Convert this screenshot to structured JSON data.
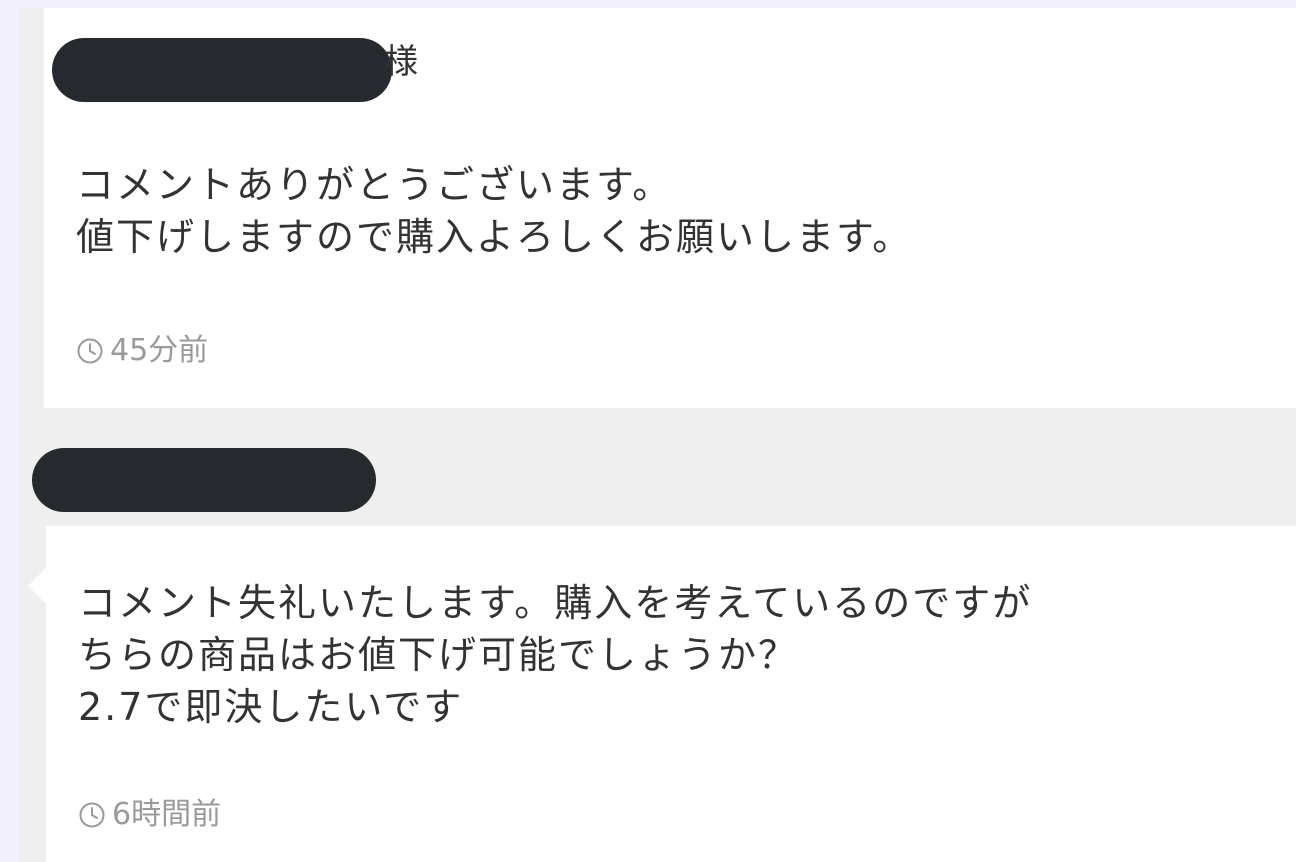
{
  "seller_reply": {
    "addressee_honorific": "様",
    "lines": [
      "コメントありがとうございます。",
      "値下げしますので購入よろしくお願いします。"
    ],
    "timestamp": "45分前",
    "timestamp_icon": "clock-icon"
  },
  "buyer_comment": {
    "lines": [
      "コメント失礼いたします。購入を考えているのですが",
      "ちらの商品はお値下げ可能でしょうか？",
      "2.7で即決したいです"
    ],
    "timestamp": "6時間前",
    "timestamp_icon": "clock-icon"
  },
  "colors": {
    "bubble": "#ffffff",
    "thread_bg": "#efefef",
    "page_bg": "#f2f1fb",
    "text": "#333333",
    "timestamp": "#9a9a9a",
    "redaction": "#262a2e"
  }
}
